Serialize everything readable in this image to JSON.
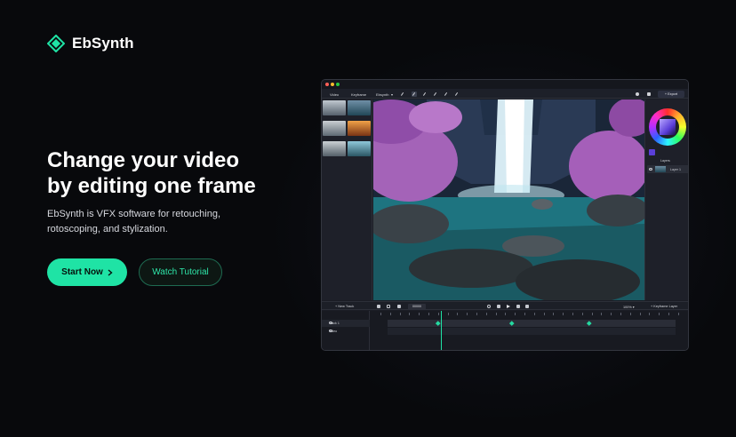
{
  "brand": {
    "name": "EbSynth",
    "accent": "#1fe3a5"
  },
  "hero": {
    "headline_line1": "Change your video",
    "headline_line2": "by editing one frame",
    "subhead_line1": "EbSynth is VFX software for retouching,",
    "subhead_line2": "rotoscoping, and stylization."
  },
  "cta": {
    "primary_label": "Start Now",
    "primary_icon": "chevron-right-icon",
    "secondary_label": "Watch Tutorial"
  },
  "app": {
    "toolbar": {
      "video_tab": "Video",
      "keyframe_tab": "Keyframe",
      "mode_select": "Ebsynth",
      "export_label": "Export"
    },
    "right_panel": {
      "layers_title": "Layers",
      "layer_name": "Layer 1",
      "selected_color": "#5b3fd9"
    },
    "bottom_bar": {
      "new_track_label": "New Track",
      "frame_value": "00000",
      "zoom_value": "100%",
      "keyframe_layer_label": "Keyframe Layer"
    },
    "timeline": {
      "tracks": [
        "Track 1",
        "Video"
      ]
    }
  }
}
